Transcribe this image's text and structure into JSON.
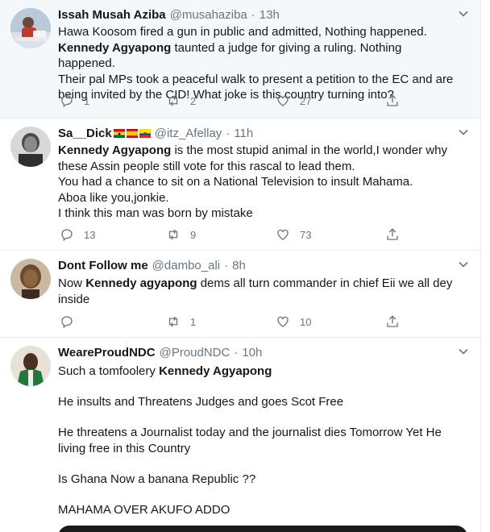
{
  "tweets": [
    {
      "name": "Issah Musah Aziba",
      "handle": "@musahaziba",
      "time": "13h",
      "lines": [
        {
          "pre": "Hawa Koosom fired a gun in public and admitted, Nothing happened.",
          "bold": "",
          "post": ""
        },
        {
          "pre": "",
          "bold": "Kennedy Agyapong",
          "post": " taunted a judge for giving a ruling. Nothing happened."
        },
        {
          "pre": "Their pal MPs took a peaceful walk to present a petition to the EC and are",
          "bold": "",
          "post": ""
        },
        {
          "pre": "being invited by the CID! What joke is this country turning into?",
          "bold": "",
          "post": ""
        }
      ],
      "replies": "1",
      "retweets": "2",
      "likes": "27"
    },
    {
      "name": "Sa__Dick",
      "handle": "@itz_Afellay",
      "time": "11h",
      "lines": [
        {
          "pre": "",
          "bold": "Kennedy Agyapong",
          "post": " is the most stupid animal in the world,I wonder why"
        },
        {
          "pre": "these Assin people still vote for this rascal to lead them.",
          "bold": "",
          "post": ""
        },
        {
          "pre": "You had a chance to sit on a National Television to insult Mahama.",
          "bold": "",
          "post": ""
        },
        {
          "pre": "Aboa like you,jonkie.",
          "bold": "",
          "post": ""
        },
        {
          "pre": "I think this man was born by mistake",
          "bold": "",
          "post": ""
        }
      ],
      "replies": "13",
      "retweets": "9",
      "likes": "73"
    },
    {
      "name": "Dont Follow me",
      "handle": "@dambo_ali",
      "time": "8h",
      "lines": [
        {
          "pre": "Now ",
          "bold": "Kennedy agyapong",
          "post": " dems all turn commander in chief Eii we all dey"
        },
        {
          "pre": "inside",
          "bold": "",
          "post": ""
        }
      ],
      "replies": "",
      "retweets": "1",
      "likes": "10"
    },
    {
      "name": "WeareProudNDC",
      "handle": "@ProudNDC",
      "time": "10h",
      "lines": [
        {
          "pre": "Such a tomfoolery ",
          "bold": "Kennedy Agyapong",
          "post": ""
        },
        {
          "pre": "",
          "bold": "",
          "post": ""
        },
        {
          "pre": "He insults and Threatens Judges and goes Scot Free",
          "bold": "",
          "post": ""
        },
        {
          "pre": "",
          "bold": "",
          "post": ""
        },
        {
          "pre": "He threatens a Journalist today and the journalist dies Tomorrow Yet He",
          "bold": "",
          "post": ""
        },
        {
          "pre": "living free in this Country",
          "bold": "",
          "post": ""
        },
        {
          "pre": "",
          "bold": "",
          "post": ""
        },
        {
          "pre": "Is Ghana Now a banana Republic ??",
          "bold": "",
          "post": ""
        },
        {
          "pre": "",
          "bold": "",
          "post": ""
        },
        {
          "pre": "MAHAMA OVER AKUFO ADDO",
          "bold": "",
          "post": ""
        }
      ]
    }
  ],
  "separator": "·",
  "icons": {
    "reply": "reply-icon",
    "retweet": "retweet-icon",
    "like": "heart-icon",
    "share": "share-icon",
    "more": "chevron-down-icon",
    "flags": [
      "ghana-flag-icon",
      "spain-flag-icon",
      "ecuador-flag-icon"
    ]
  },
  "colors": {
    "text": "#14171a",
    "secondary": "#657786",
    "border": "#e6ecf0",
    "highlight_bg": "#f5f8fa"
  }
}
